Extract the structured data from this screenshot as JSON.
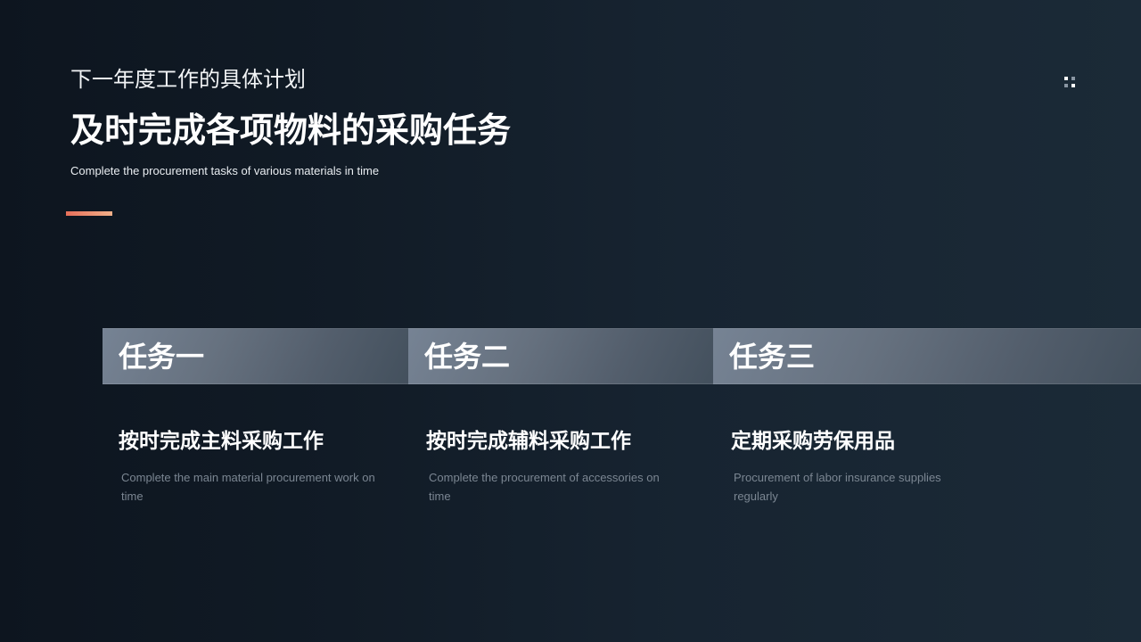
{
  "header": {
    "kicker": "下一年度工作的具体计划",
    "title": "及时完成各项物料的采购任务",
    "subtitle": "Complete the procurement tasks of various materials in time"
  },
  "decor": {
    "accent_gradient": [
      "#e76f5a",
      "#f1b089"
    ],
    "corner_icon": "grid-dots-icon"
  },
  "tasks": [
    {
      "tab_label": "任务一",
      "heading": "按时完成主料采购工作",
      "description": "Complete the main material procurement work on time"
    },
    {
      "tab_label": "任务二",
      "heading": "按时完成辅料采购工作",
      "description": "Complete the procurement of accessories on time"
    },
    {
      "tab_label": "任务三",
      "heading": "定期采购劳保用品",
      "description": "Procurement of labor insurance supplies regularly"
    }
  ]
}
